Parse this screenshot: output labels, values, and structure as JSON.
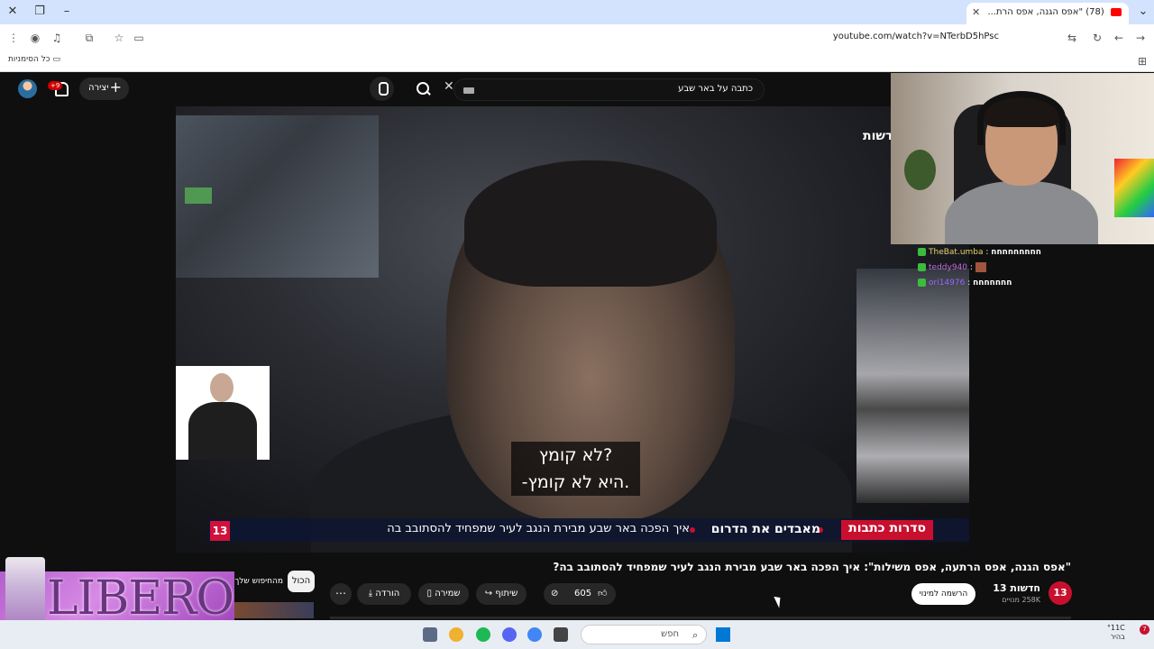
{
  "browser": {
    "tab_title": "(78) \"אפס הגנה, אפס הרת...",
    "url": "youtube.com/watch?v=NTerbD5hPsc",
    "bookmarks_all": "כל הסימניות"
  },
  "youtube": {
    "search_query": "כתבה על באר שבע",
    "create_label": "יצירה",
    "notifications_badge": "+9"
  },
  "video": {
    "channel_logo": "חדשות",
    "subtitle_line1": "?לא קומץ",
    "subtitle_line2": ".היא לא קומץ-",
    "lower_third": {
      "logo": "13",
      "series": "סדרות כתבות",
      "program": "מאבדים את הדרום",
      "headline": "איך הפכה באר שבע מבירת הנגב לעיר שמפחיד להסתובב בה"
    }
  },
  "chat": [
    {
      "user": "TheBat.umba",
      "message": "חחחחחחחחח"
    },
    {
      "user": "teddy940",
      "message": ""
    },
    {
      "user": "ori14976",
      "message": "חחחחחחח"
    }
  ],
  "below_video": {
    "title": "\"אפס הגנה, אפס הרתעה, אפס משילות\": איך הפכה באר שבע מבירת הנגב לעיר שמפחיד להסתובב בה?",
    "channel_name": "חדשות 13",
    "channel_subs": "258K מנויים",
    "subscribe_label": "הרשמה למינוי",
    "like_count": "605",
    "share_label": "שיתוף",
    "save_label": "שמירה",
    "download_label": "הורדה",
    "chip_all": "הכול",
    "chip_2": "מהחיפוש שלך"
  },
  "ad": {
    "brand": "LIBERO"
  },
  "taskbar": {
    "search_placeholder": "חפש",
    "temp": "°11C",
    "weather": "בהיר",
    "notif_count": "7"
  }
}
